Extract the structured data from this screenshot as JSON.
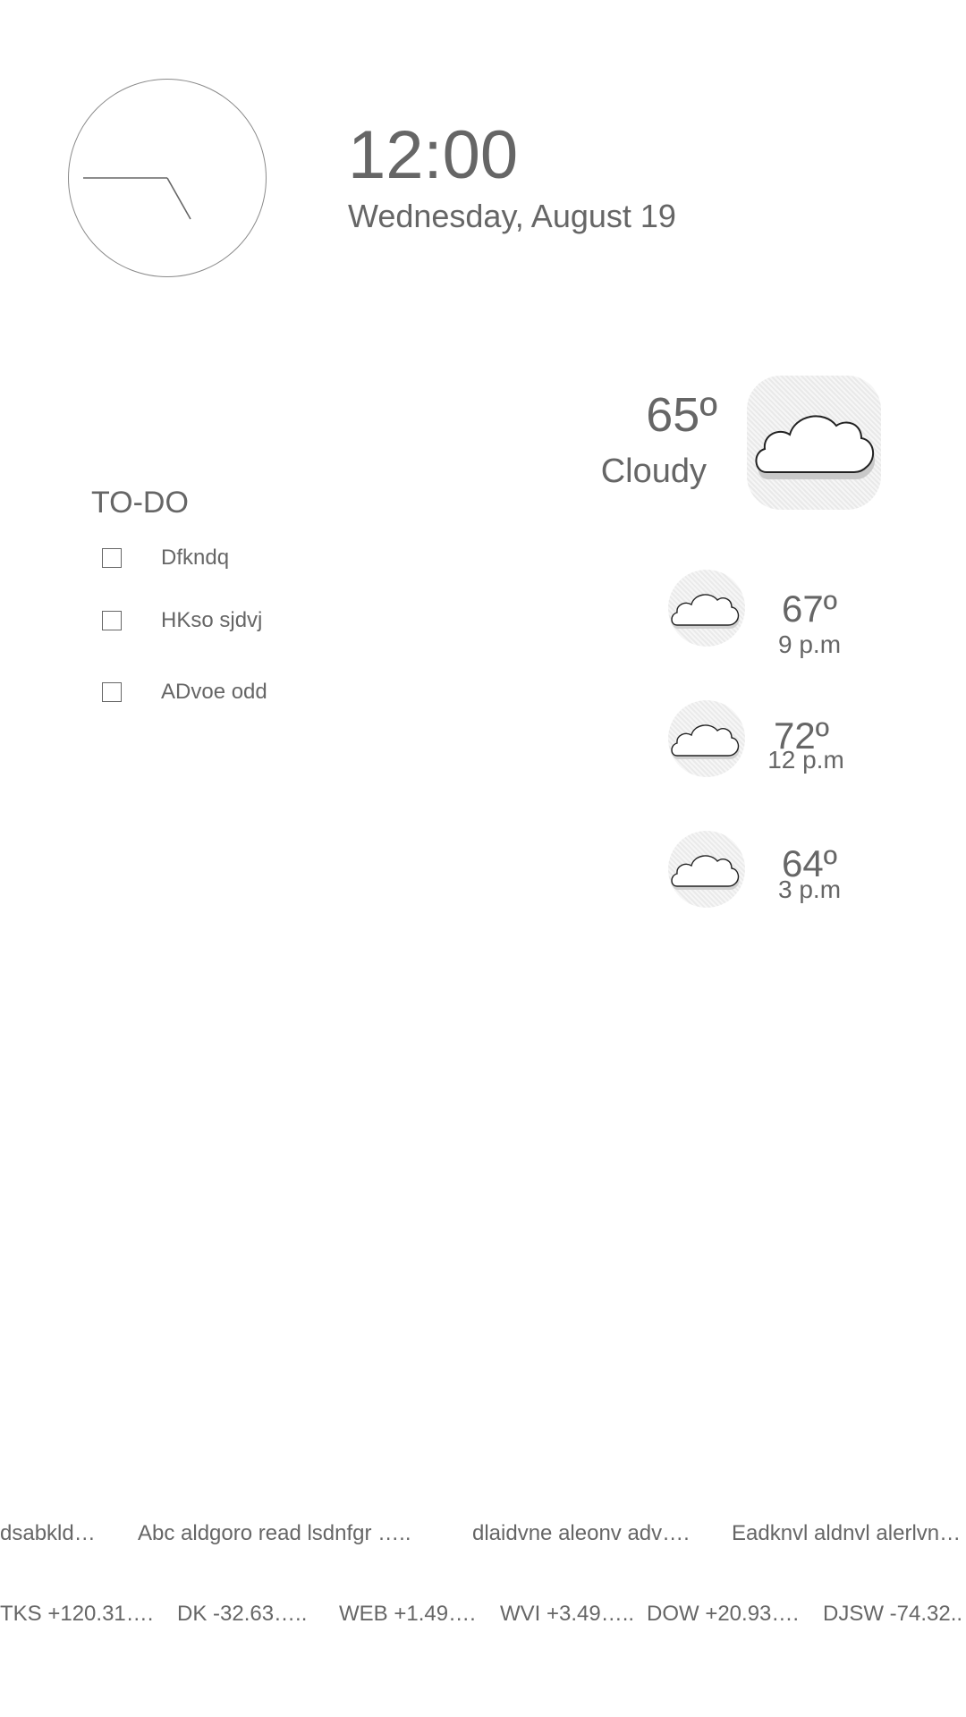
{
  "clock": {
    "time": "12:00",
    "date": "Wednesday, August 19"
  },
  "weather": {
    "current": {
      "temp": "65º",
      "condition": "Cloudy",
      "icon": "cloud-icon"
    },
    "forecast": [
      {
        "temp": "67º",
        "time": "9 p.m",
        "icon": "cloud-icon"
      },
      {
        "temp": "72º",
        "time": "12 p.m",
        "icon": "cloud-icon"
      },
      {
        "temp": "64º",
        "time": "3 p.m",
        "icon": "cloud-icon"
      }
    ]
  },
  "todo": {
    "title": "TO-DO",
    "items": [
      {
        "label": "Dfkndq",
        "checked": false
      },
      {
        "label": "HKso sjdvj",
        "checked": false
      },
      {
        "label": "ADvoe odd",
        "checked": false
      }
    ]
  },
  "news": [
    "dsabkld…",
    "Abc aldgoro read lsdnfgr …..",
    "dlaidvne aleonv adv….",
    "Eadknvl aldnvl alerlvn…"
  ],
  "stocks": [
    "TKS +120.31….",
    "DK -32.63…..",
    "WEB +1.49….",
    "WVI +3.49…..",
    "DOW +20.93….",
    "DJSW -74.32.."
  ],
  "colors": {
    "text": "#666666",
    "icon_bg": "#f1f1f1"
  }
}
